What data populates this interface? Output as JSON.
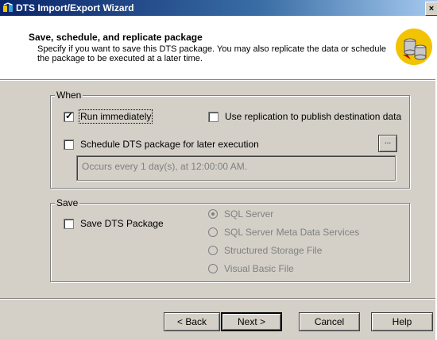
{
  "window": {
    "title": "DTS Import/Export Wizard",
    "close_label": "×"
  },
  "header": {
    "title": "Save, schedule, and replicate package",
    "description": "Specify if you want to save this DTS package.  You may also replicate the data or schedule the package to be executed at a later time."
  },
  "when_group": {
    "legend": "When",
    "run_immediately": {
      "label": "Run immediately",
      "checked": true
    },
    "use_replication": {
      "label": "Use replication to publish destination data",
      "checked": false
    },
    "schedule": {
      "label": "Schedule DTS package for later execution",
      "checked": false
    },
    "schedule_browse_label": "...",
    "schedule_text": "Occurs every 1 day(s), at 12:00:00 AM."
  },
  "save_group": {
    "legend": "Save",
    "save_package": {
      "label": "Save DTS Package",
      "checked": false
    },
    "options": [
      {
        "label": "SQL Server",
        "selected": true
      },
      {
        "label": "SQL Server Meta Data Services",
        "selected": false
      },
      {
        "label": "Structured Storage File",
        "selected": false
      },
      {
        "label": "Visual Basic File",
        "selected": false
      }
    ]
  },
  "buttons": {
    "back": "< Back",
    "next": "Next >",
    "cancel": "Cancel",
    "help": "Help"
  }
}
